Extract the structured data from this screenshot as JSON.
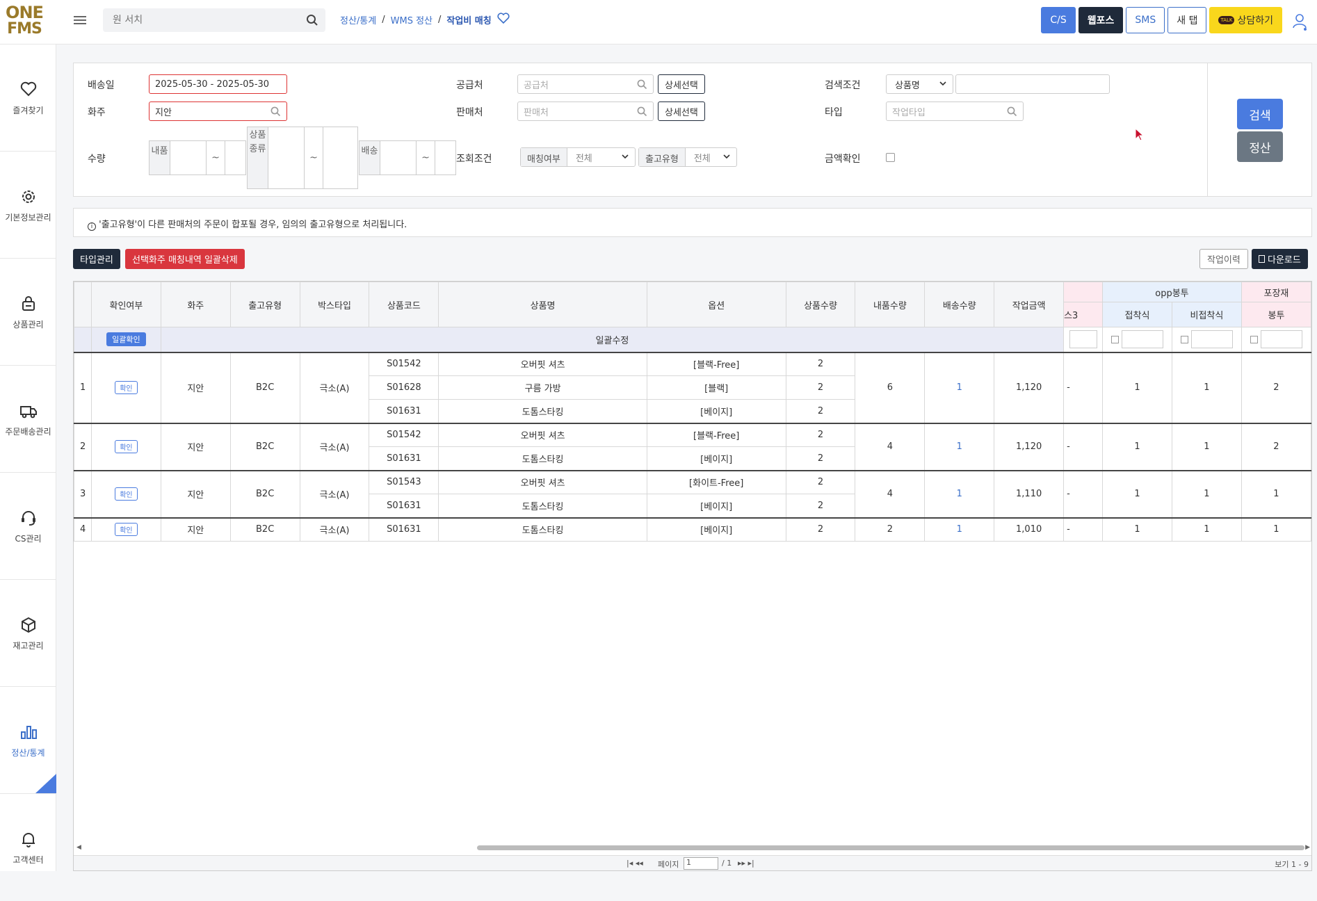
{
  "app": {
    "logo_line1": "ONE",
    "logo_line2": "FMS"
  },
  "search": {
    "placeholder": "원 서치"
  },
  "breadcrumb": {
    "items": [
      "정산/통계",
      "WMS 정산",
      "작업비 매칭"
    ]
  },
  "topbuttons": {
    "cs": "C/S",
    "wepos": "웹포스",
    "sms": "SMS",
    "newtab": "새 탭",
    "consult": "상담하기",
    "talk": "TALK"
  },
  "sidebar": {
    "items": [
      {
        "label": "즐겨찾기",
        "icon": "heart-icon"
      },
      {
        "label": "기본정보관리",
        "icon": "gear-icon"
      },
      {
        "label": "상품관리",
        "icon": "bag-icon"
      },
      {
        "label": "주문배송관리",
        "icon": "truck-icon"
      },
      {
        "label": "CS관리",
        "icon": "headset-icon"
      },
      {
        "label": "재고관리",
        "icon": "box-icon"
      },
      {
        "label": "정산/통계",
        "icon": "bar-chart-icon"
      },
      {
        "label": "고객센터",
        "icon": "bell-icon"
      }
    ]
  },
  "filters": {
    "ship_date_label": "배송일",
    "ship_date_value": "2025-05-30 - 2025-05-30",
    "owner_label": "화주",
    "owner_value": "지안",
    "qty_label": "수량",
    "qty_inner_label": "내품",
    "qty_kind_label": "상품종류",
    "qty_ship_label": "배송",
    "tilde": "~",
    "supplier_label": "공급처",
    "supplier_placeholder": "공급처",
    "detail_select": "상세선택",
    "seller_label": "판매처",
    "seller_placeholder": "판매처",
    "query_label": "조회조건",
    "match_label": "매칭여부",
    "match_value": "전체",
    "outtype_label": "출고유형",
    "outtype_value": "전체",
    "cond_label": "검색조건",
    "cond_value": "상품명",
    "type_label": "타입",
    "type_placeholder": "작업타입",
    "amount_label": "금액확인",
    "search_btn": "검색",
    "settle_btn": "정산"
  },
  "notice": {
    "text": "'출고유형'이 다른 판매처의 주문이 합포될 경우, 임의의 출고유형으로 처리됩니다."
  },
  "actions": {
    "type_manage": "타입관리",
    "bulk_delete": "선택화주 매칭내역 일괄삭제",
    "history": "작업이력",
    "download": "다운로드"
  },
  "table": {
    "headers": [
      "확인여부",
      "화주",
      "출고유형",
      "박스타입",
      "상품코드",
      "상품명",
      "옵션",
      "상품수량",
      "내품수량",
      "배송수량",
      "작업금액"
    ],
    "group_opp": "opp봉투",
    "group_pack": "포장재",
    "sub_cut": "스3",
    "sub_adh": "접착식",
    "sub_nonadh": "비접착식",
    "sub_bag": "봉투",
    "bulk_confirm": "일괄확인",
    "bulk_edit": "일괄수정",
    "confirm": "확인",
    "groups": [
      {
        "no": "1",
        "owner": "지안",
        "out": "B2C",
        "box": "극소(A)",
        "inner": "6",
        "ship": "1",
        "amount": "1,120",
        "c3": "-",
        "adh": "1",
        "nonadh": "1",
        "bag": "2",
        "items": [
          {
            "code": "S01542",
            "name": "오버핏 셔츠",
            "opt": "[블랙-Free]",
            "qty": "2"
          },
          {
            "code": "S01628",
            "name": "구름 가방",
            "opt": "[블랙]",
            "qty": "2"
          },
          {
            "code": "S01631",
            "name": "도톰스타킹",
            "opt": "[베이지]",
            "qty": "2"
          }
        ]
      },
      {
        "no": "2",
        "owner": "지안",
        "out": "B2C",
        "box": "극소(A)",
        "inner": "4",
        "ship": "1",
        "amount": "1,120",
        "c3": "-",
        "adh": "1",
        "nonadh": "1",
        "bag": "2",
        "items": [
          {
            "code": "S01542",
            "name": "오버핏 셔츠",
            "opt": "[블랙-Free]",
            "qty": "2"
          },
          {
            "code": "S01631",
            "name": "도톰스타킹",
            "opt": "[베이지]",
            "qty": "2"
          }
        ]
      },
      {
        "no": "3",
        "owner": "지안",
        "out": "B2C",
        "box": "극소(A)",
        "inner": "4",
        "ship": "1",
        "amount": "1,110",
        "c3": "-",
        "adh": "1",
        "nonadh": "1",
        "bag": "1",
        "items": [
          {
            "code": "S01543",
            "name": "오버핏 셔츠",
            "opt": "[화이트-Free]",
            "qty": "2"
          },
          {
            "code": "S01631",
            "name": "도톰스타킹",
            "opt": "[베이지]",
            "qty": "2"
          }
        ]
      },
      {
        "no": "4",
        "owner": "지안",
        "out": "B2C",
        "box": "극소(A)",
        "inner": "2",
        "ship": "1",
        "amount": "1,010",
        "c3": "-",
        "adh": "1",
        "nonadh": "1",
        "bag": "1",
        "items": [
          {
            "code": "S01631",
            "name": "도톰스타킹",
            "opt": "[베이지]",
            "qty": "2"
          }
        ]
      }
    ]
  },
  "pager": {
    "page_label": "페이지",
    "page_value": "1",
    "total": "/ 1",
    "view": "보기 1 - 9"
  },
  "colors": {
    "accent": "#4a7bdf",
    "danger": "#d9363e",
    "dark": "#1f2a3a",
    "kakao": "#f9d71c"
  }
}
